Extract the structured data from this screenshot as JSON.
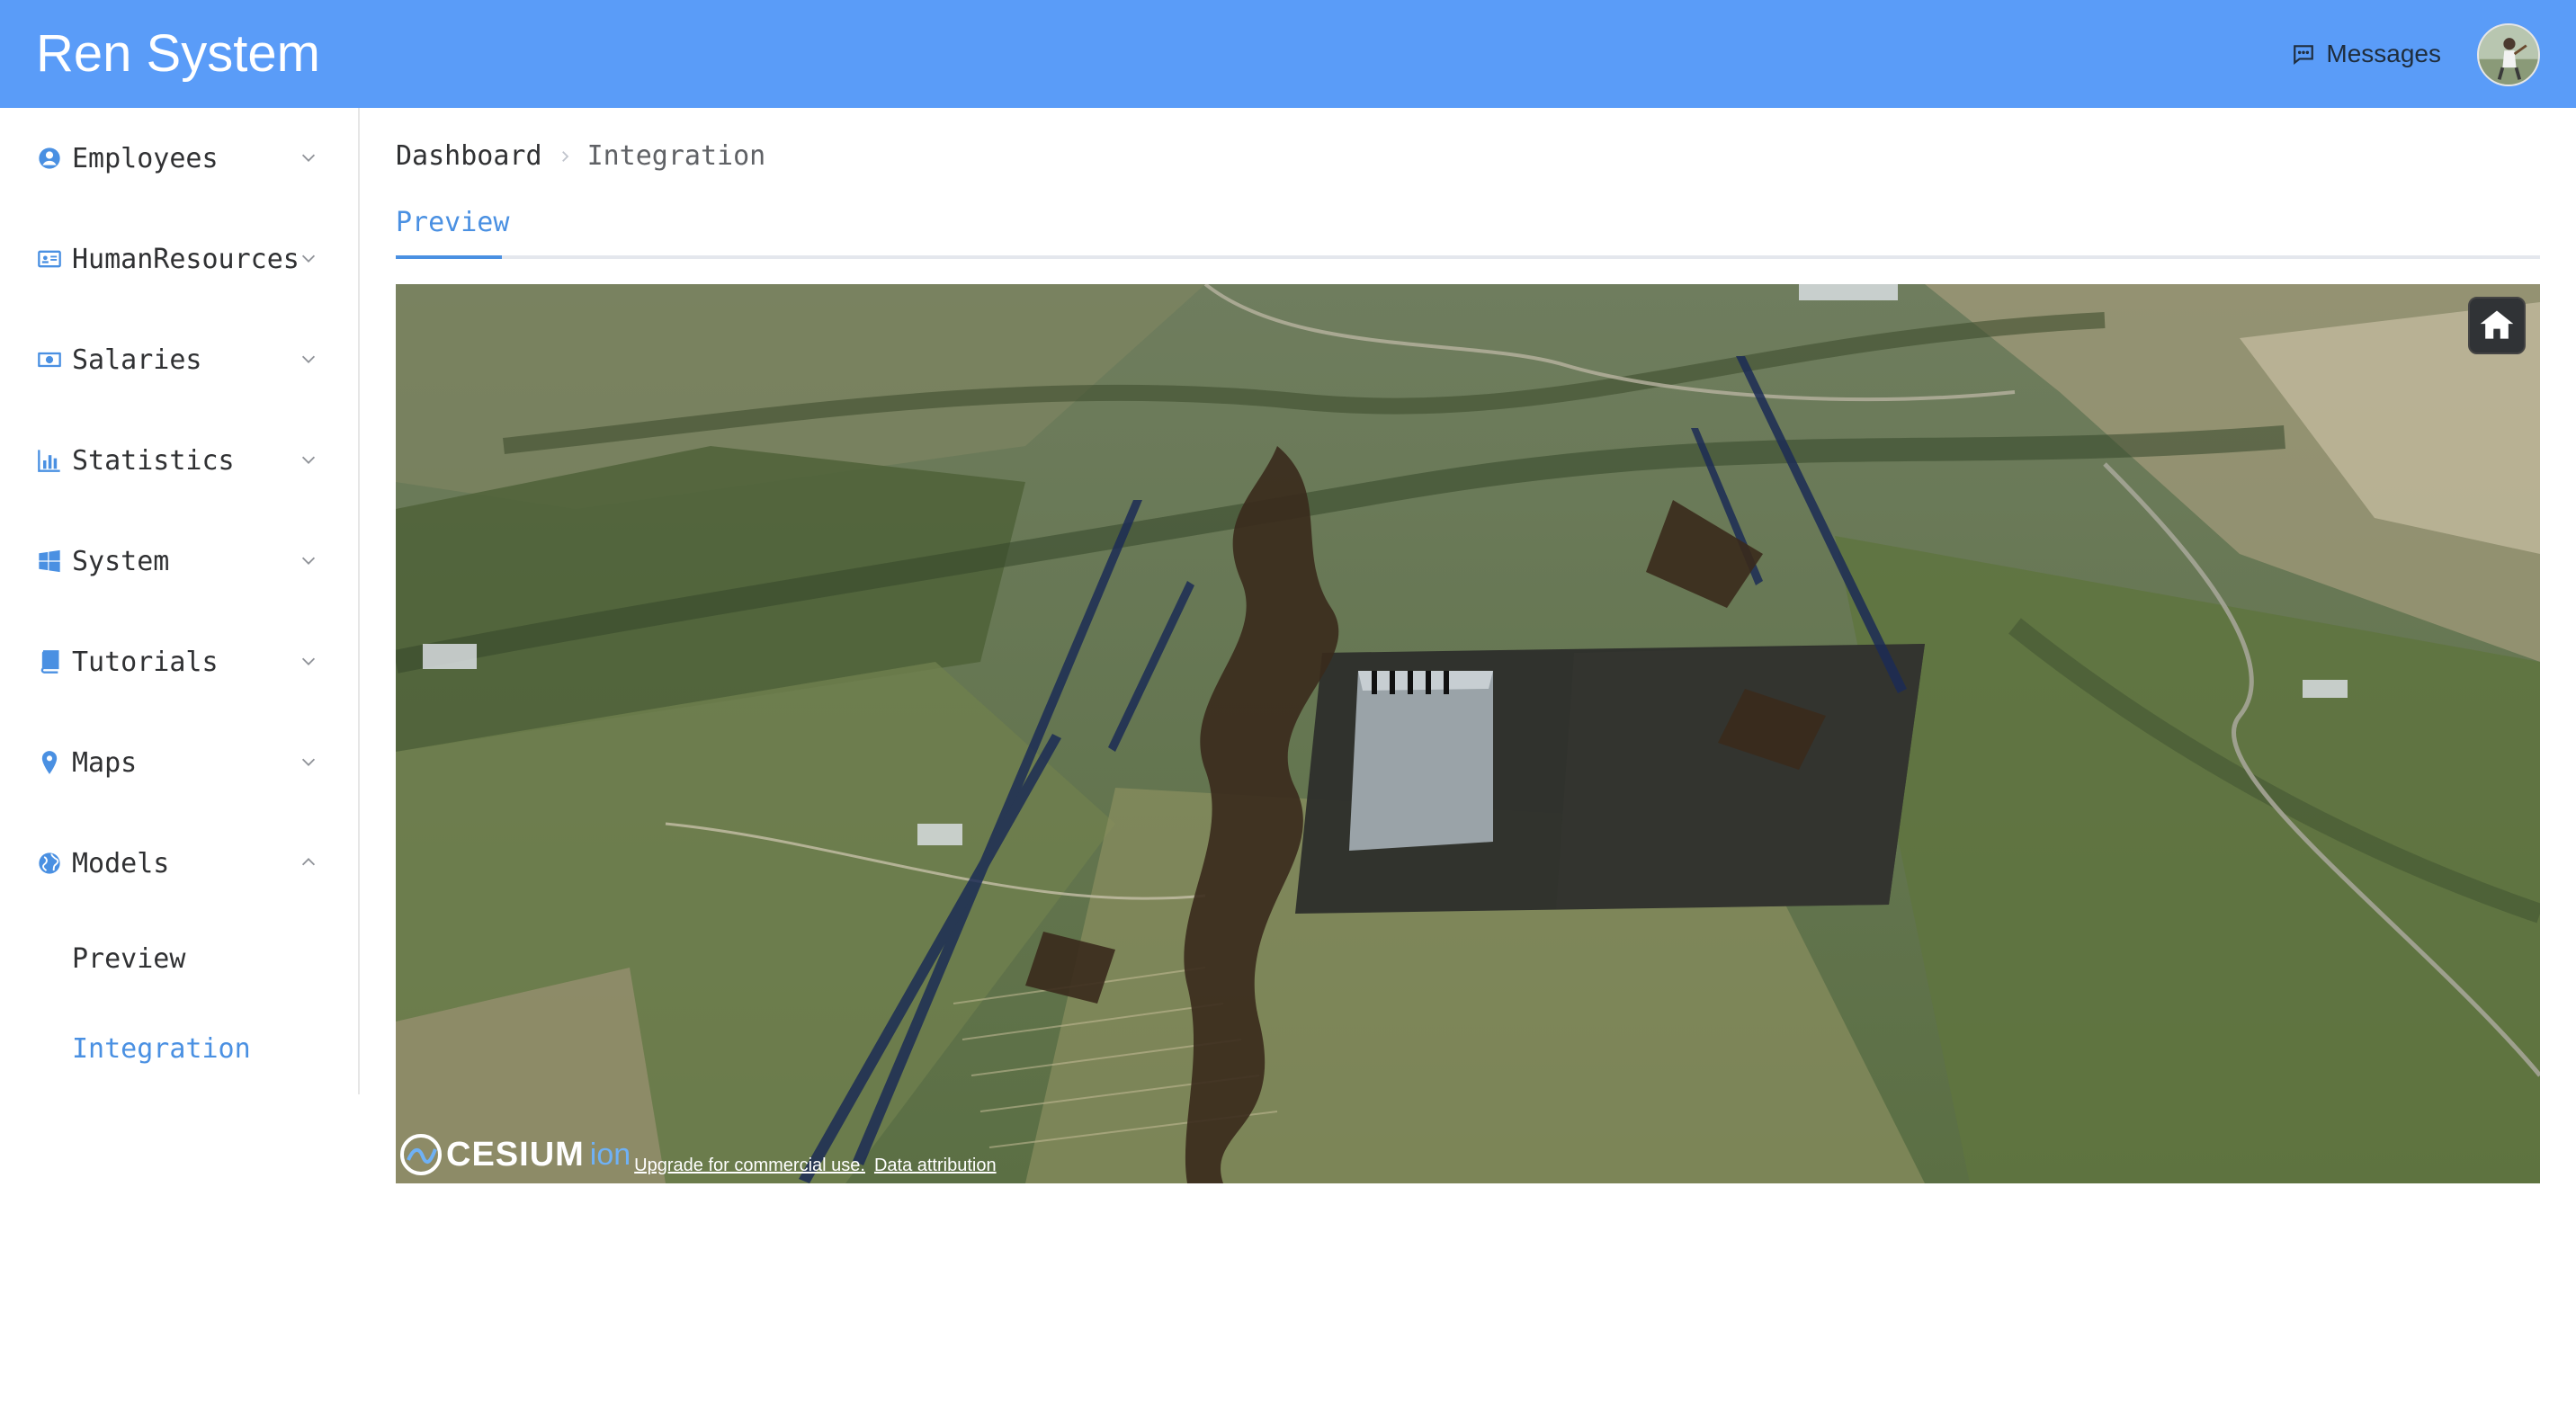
{
  "header": {
    "app_title": "Ren System",
    "messages_label": "Messages",
    "avatar_icon": "user-avatar"
  },
  "sidebar": {
    "items": [
      {
        "label": "Employees",
        "icon": "user-circle-icon",
        "expanded": false
      },
      {
        "label": "HumanResources",
        "icon": "id-card-icon",
        "expanded": false
      },
      {
        "label": "Salaries",
        "icon": "money-icon",
        "expanded": false
      },
      {
        "label": "Statistics",
        "icon": "bar-chart-icon",
        "expanded": false
      },
      {
        "label": "System",
        "icon": "windows-icon",
        "expanded": false
      },
      {
        "label": "Tutorials",
        "icon": "book-icon",
        "expanded": false
      },
      {
        "label": "Maps",
        "icon": "location-pin-icon",
        "expanded": false
      },
      {
        "label": "Models",
        "icon": "globe-icon",
        "expanded": true
      }
    ],
    "submenu": [
      {
        "label": "Preview",
        "active": false
      },
      {
        "label": "Integration",
        "active": true
      }
    ]
  },
  "breadcrumb": {
    "items": [
      "Dashboard",
      "Integration"
    ]
  },
  "tabs": [
    {
      "label": "Preview",
      "active": true
    }
  ],
  "viewer": {
    "logo_text": "CESIUM",
    "logo_suffix": "ion",
    "credits": [
      "Upgrade for commercial use.",
      "Data attribution"
    ],
    "home_button_icon": "home-icon"
  },
  "colors": {
    "header_bg": "#5a9cf8",
    "accent": "#4a90e2",
    "text": "#303133"
  }
}
